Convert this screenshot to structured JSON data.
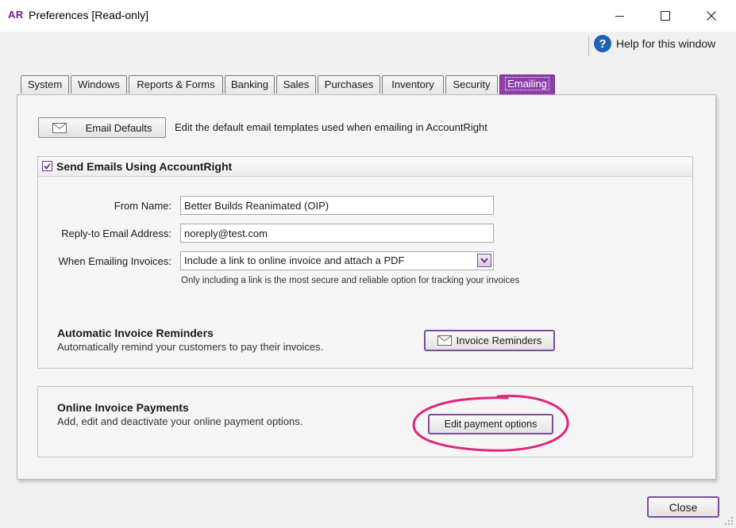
{
  "window": {
    "app_badge": "AR",
    "title": "Preferences [Read-only]"
  },
  "help": {
    "label": "Help for this window",
    "icon": "help-icon"
  },
  "tabs": [
    {
      "label": "System"
    },
    {
      "label": "Windows"
    },
    {
      "label": "Reports & Forms"
    },
    {
      "label": "Banking"
    },
    {
      "label": "Sales"
    },
    {
      "label": "Purchases"
    },
    {
      "label": "Inventory"
    },
    {
      "label": "Security"
    },
    {
      "label": "Emailing",
      "active": true
    }
  ],
  "email_defaults": {
    "button_label": "Email Defaults",
    "description": "Edit the default email templates used when emailing in AccountRight"
  },
  "send_emails": {
    "checkbox_label": "Send Emails Using AccountRight",
    "checked": true,
    "from_name_label": "From Name:",
    "from_name_value": "Better Builds Reanimated (OIP)",
    "reply_to_label": "Reply-to Email Address:",
    "reply_to_value": "noreply@test.com",
    "invoices_label": "When Emailing Invoices:",
    "invoices_value": "Include a link to online invoice and attach a PDF",
    "invoices_hint": "Only including a link is the most secure and reliable option for tracking your invoices"
  },
  "reminders": {
    "title": "Automatic Invoice Reminders",
    "description": "Automatically remind your customers to pay their invoices.",
    "button_label": "Invoice Reminders"
  },
  "payments": {
    "title": "Online Invoice Payments",
    "description": "Add, edit and deactivate your online payment options.",
    "button_label": "Edit payment options"
  },
  "footer": {
    "close_label": "Close"
  },
  "colors": {
    "accent": "#8c3fa8",
    "highlight_circle": "#e0267a"
  }
}
